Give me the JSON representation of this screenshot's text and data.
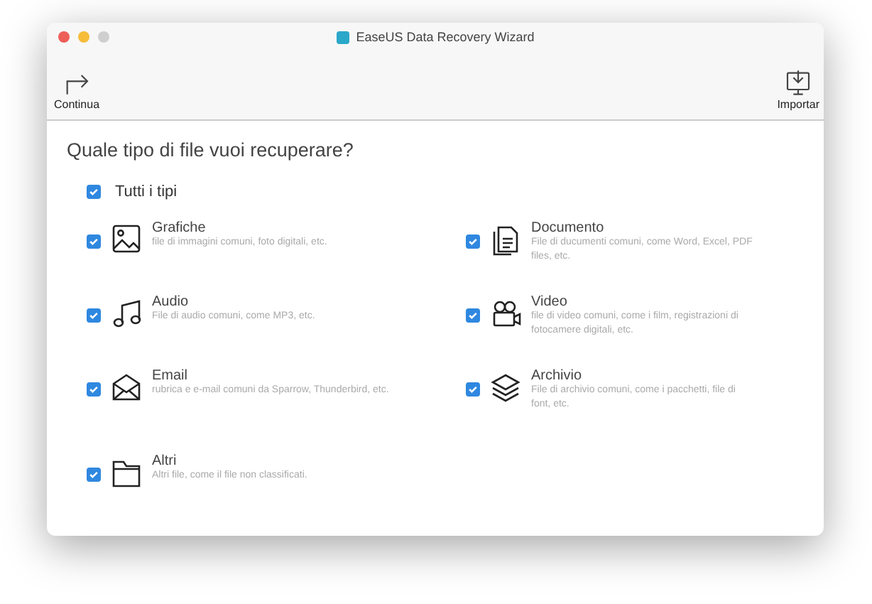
{
  "window": {
    "title": "EaseUS Data Recovery Wizard"
  },
  "toolbar": [
    {
      "kind": "continue",
      "label": "Continua"
    },
    {
      "kind": "import",
      "label": "Importar"
    }
  ],
  "question": "Quale tipo di file vuoi recuperare?",
  "all_types": {
    "label": "Tutti i tipi",
    "checked": true
  },
  "file_types": [
    {
      "kind": "image",
      "name": "Grafiche",
      "description": "file di immagini comuni, foto digitali, etc.",
      "checked": true
    },
    {
      "kind": "document",
      "name": "Documento",
      "description": "File di ducumenti comuni, come Word, Excel, PDF files, etc.",
      "checked": true
    },
    {
      "kind": "music",
      "name": "Audio",
      "description": "File di audio comuni, come MP3, etc.",
      "checked": true
    },
    {
      "kind": "video",
      "name": "Video",
      "description": "file di video comuni, come i film, registrazioni di fotocamere digitali, etc.",
      "checked": true
    },
    {
      "kind": "mail",
      "name": "Email",
      "description": "rubrica e e-mail comuni da Sparrow, Thunderbird, etc.",
      "checked": true
    },
    {
      "kind": "layers",
      "name": "Archivio",
      "description": "File di archivio comuni, come i pacchetti, file di font, etc.",
      "checked": true
    },
    {
      "kind": "folder",
      "name": "Altri",
      "description": "Altri file, come il file non classificati.",
      "checked": true
    }
  ]
}
